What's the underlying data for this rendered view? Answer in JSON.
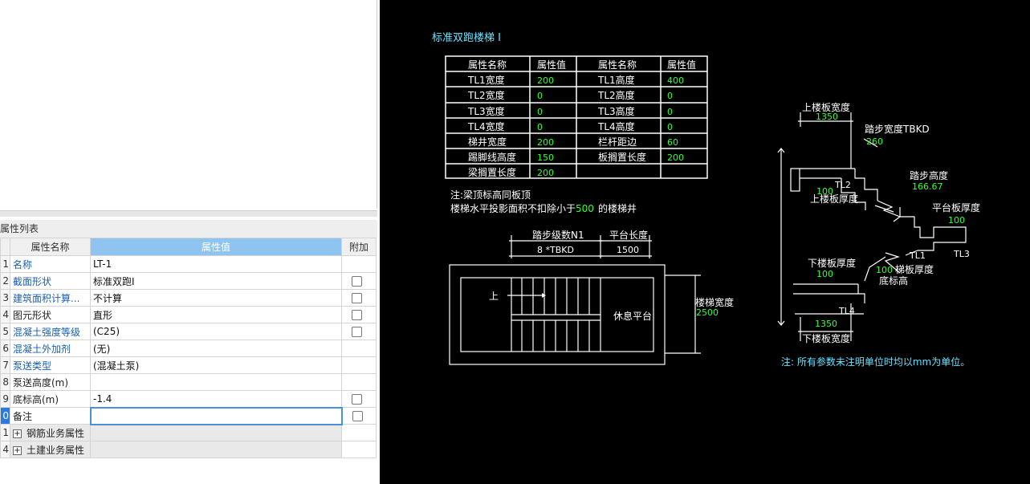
{
  "properties_panel": {
    "title": "属性列表",
    "headers": {
      "name": "属性名称",
      "value": "属性值",
      "extra": "附加"
    },
    "rows": [
      {
        "idx": "1",
        "name": "名称",
        "value": "LT-1",
        "blue": true,
        "check": false
      },
      {
        "idx": "2",
        "name": "截面形状",
        "value": "标准双跑I",
        "blue": true,
        "check": true
      },
      {
        "idx": "3",
        "name": "建筑面积计算...",
        "value": "不计算",
        "blue": true,
        "check": true
      },
      {
        "idx": "4",
        "name": "图元形状",
        "value": "直形",
        "blue": false,
        "check": true
      },
      {
        "idx": "5",
        "name": "混凝土强度等级",
        "value": "(C25)",
        "blue": true,
        "check": true
      },
      {
        "idx": "6",
        "name": "混凝土外加剂",
        "value": "(无)",
        "blue": true,
        "check": false
      },
      {
        "idx": "7",
        "name": "泵送类型",
        "value": "(混凝土泵)",
        "blue": true,
        "check": false
      },
      {
        "idx": "8",
        "name": "泵送高度(m)",
        "value": "",
        "blue": false,
        "check": false
      },
      {
        "idx": "9",
        "name": "底标高(m)",
        "value": "-1.4",
        "blue": false,
        "check": true
      },
      {
        "idx": "0",
        "name": "备注",
        "value": "",
        "blue": false,
        "check": true,
        "active": true
      }
    ],
    "groups": [
      {
        "idx": "1",
        "label": "钢筋业务属性"
      },
      {
        "idx": "4",
        "label": "土建业务属性"
      }
    ]
  },
  "drawing": {
    "title": "标准双跑楼梯 I",
    "param_table": {
      "headers": [
        "属性名称",
        "属性值",
        "属性名称",
        "属性值"
      ],
      "rows": [
        [
          "TL1宽度",
          "200",
          "TL1高度",
          "400"
        ],
        [
          "TL2宽度",
          "0",
          "TL2高度",
          "0"
        ],
        [
          "TL3宽度",
          "0",
          "TL3高度",
          "0"
        ],
        [
          "TL4宽度",
          "0",
          "TL4高度",
          "0"
        ],
        [
          "梯井宽度",
          "200",
          "栏杆距边",
          "60"
        ],
        [
          "踢脚线高度",
          "150",
          "板搁置长度",
          "200"
        ],
        [
          "梁搁置长度",
          "200",
          "",
          ""
        ]
      ]
    },
    "note1": "注:梁顶标高同板顶",
    "note2_prefix": "楼梯水平投影面积不扣除小于",
    "note2_value": "500",
    "note2_suffix": "的楼梯井",
    "plan": {
      "steps_label": "踏步级数N1",
      "steps_value": "8  *TBKD",
      "platform_label": "平台长度",
      "platform_value": "1500",
      "up_label": "上",
      "rest_label": "休息平台",
      "width_label": "楼梯宽度",
      "width_value": "2500"
    },
    "section": {
      "top_slab_width_label": "上楼板宽度",
      "top_slab_width_value": "1350",
      "tread_width_label": "踏步宽度TBKD",
      "tread_width_value": "260",
      "tread_height_label": "踏步高度",
      "tread_height_value": "166.67",
      "tl2": "TL2",
      "top_slab_thk_value": "100",
      "top_slab_thk_label": "上楼板厚度",
      "platform_thk_label": "平台板厚度",
      "platform_thk_value": "100",
      "tl3": "TL3",
      "tl1": "TL1",
      "bottom_slab_thk_label": "下楼板厚度",
      "bottom_slab_thk_value": "100",
      "stair_thk_value": "100",
      "stair_thk_label": "梯板厚度",
      "bottom_elev_label": "底标高",
      "tl4": "TL4",
      "bottom_slab_width_value": "1350",
      "bottom_slab_width_label": "下楼板宽度"
    },
    "unit_note": "注: 所有参数未注明单位时均以mm为单位。"
  },
  "colors": {
    "cad_bg": "#000000",
    "cad_white": "#ffffff",
    "cad_green": "#33ff33",
    "cad_cyan": "#66e0ff",
    "header_blue": "#8fc3f0"
  }
}
